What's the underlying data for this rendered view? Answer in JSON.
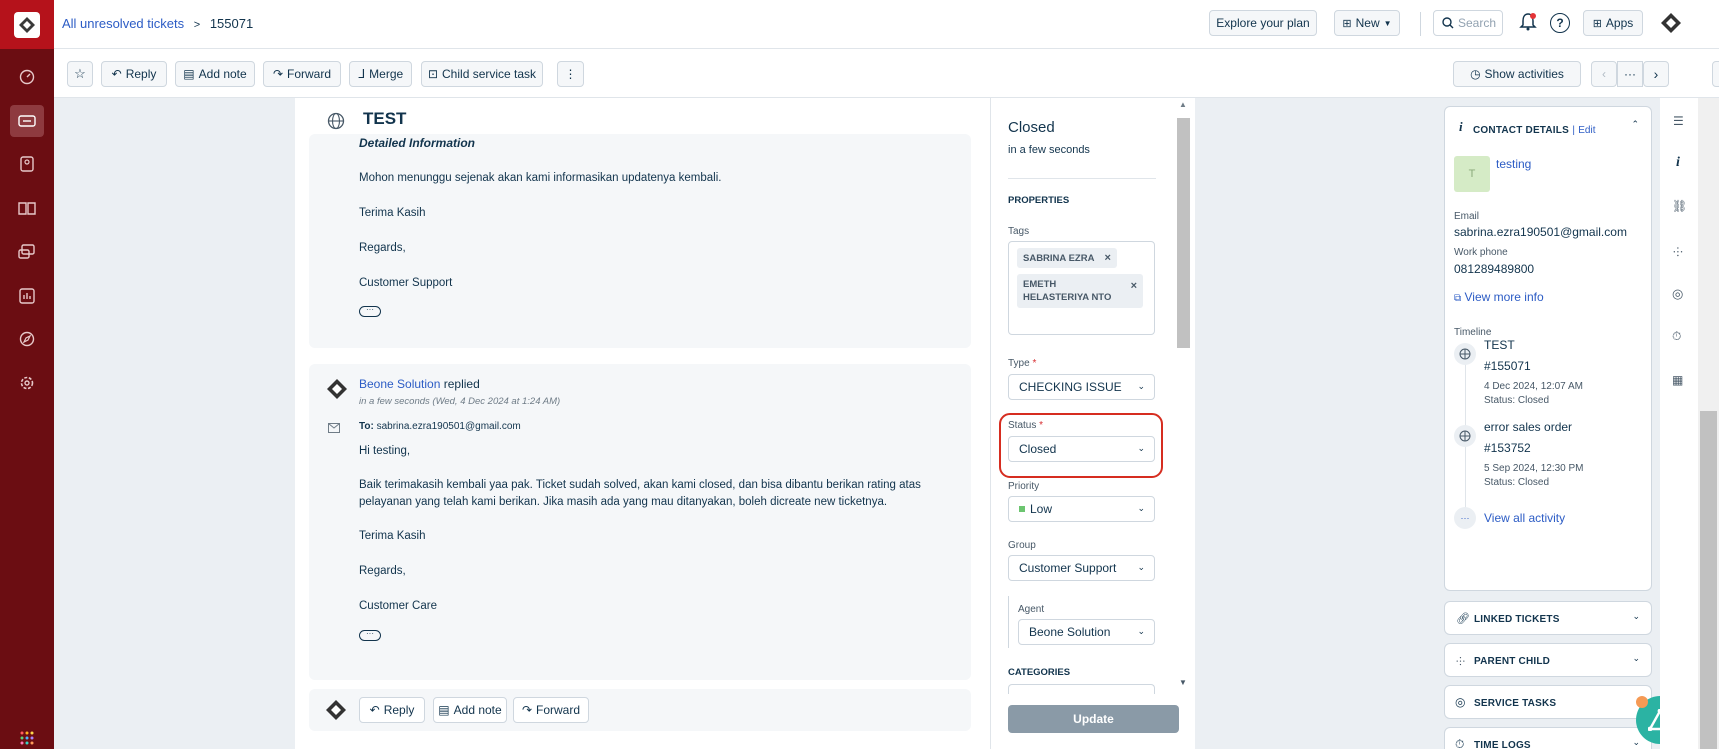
{
  "breadcrumb": {
    "parent": "All unresolved tickets",
    "separator": ">",
    "ticket_id": "155071"
  },
  "header": {
    "explore": "Explore your plan",
    "new": "New",
    "search_placeholder": "Search",
    "apps": "Apps",
    "help": "?"
  },
  "toolbar": {
    "reply": "Reply",
    "add_note": "Add note",
    "forward": "Forward",
    "merge": "Merge",
    "child_task": "Child service task",
    "more": "⋮",
    "show_activities": "Show activities",
    "pager_more": "···"
  },
  "conversation": {
    "subject": "TEST",
    "first_message": {
      "heading": "Detailed Information",
      "lines": [
        "Mohon menunggu sejenak akan kami informasikan updatenya kembali.",
        "Terima Kasih",
        "Regards,",
        "Customer Support"
      ]
    },
    "reply": {
      "author": "Beone Solution",
      "action": "replied",
      "time": "in a few seconds (Wed, 4 Dec 2024 at 1:24 AM)",
      "to_label": "To:",
      "to_email": "sabrina.ezra190501@gmail.com",
      "greeting": "Hi testing,",
      "body_line1": "Baik terimakasih kembali yaa pak. Ticket sudah solved, akan kami closed, dan bisa dibantu berikan rating atas",
      "body_line2": "pelayanan yang telah kami berikan. Jika masih ada yang mau ditanyakan, boleh dicreate new ticketnya.",
      "thanks": "Terima Kasih",
      "regards": "Regards,",
      "signature": "Customer Care"
    },
    "bottom_actions": {
      "reply": "Reply",
      "add_note": "Add note",
      "forward": "Forward"
    }
  },
  "properties": {
    "status_title": "Closed",
    "status_time": "in a few seconds",
    "section": "PROPERTIES",
    "tags_label": "Tags",
    "tags": [
      "SABRINA EZRA",
      "EMETH HELASTERIYA NTO"
    ],
    "type_label": "Type",
    "type_value": "CHECKING ISSUE",
    "status_label": "Status",
    "status_value": "Closed",
    "priority_label": "Priority",
    "priority_value": "Low",
    "group_label": "Group",
    "group_value": "Customer Support",
    "agent_label": "Agent",
    "agent_value": "Beone Solution",
    "categories_label": "CATEGORIES",
    "update_button": "Update",
    "required_mark": "*"
  },
  "contact": {
    "title": "CONTACT DETAILS",
    "edit": "Edit",
    "separator": "|",
    "avatar_letter": "T",
    "name": "testing",
    "email_label": "Email",
    "email": "sabrina.ezra190501@gmail.com",
    "phone_label": "Work phone",
    "phone": "081289489800",
    "view_more": "View more info",
    "timeline_label": "Timeline",
    "timeline": [
      {
        "title": "TEST",
        "id": "#155071",
        "date": "4 Dec 2024, 12:07 AM",
        "status": "Status: Closed"
      },
      {
        "title": "error sales order",
        "id": "#153752",
        "date": "5 Sep 2024, 12:30 PM",
        "status": "Status: Closed"
      }
    ],
    "view_all": "View all activity"
  },
  "sections": {
    "linked": "LINKED TICKETS",
    "parent_child": "PARENT CHILD",
    "service_tasks": "SERVICE TASKS",
    "time_logs": "TIME LOGS"
  },
  "colors": {
    "brand_red": "#b5121b",
    "rail_dark": "#6b0d12",
    "link": "#2c5cc5",
    "highlight": "#d62d20",
    "update_btn": "#8a9aa7",
    "low_green": "#6cc570"
  }
}
